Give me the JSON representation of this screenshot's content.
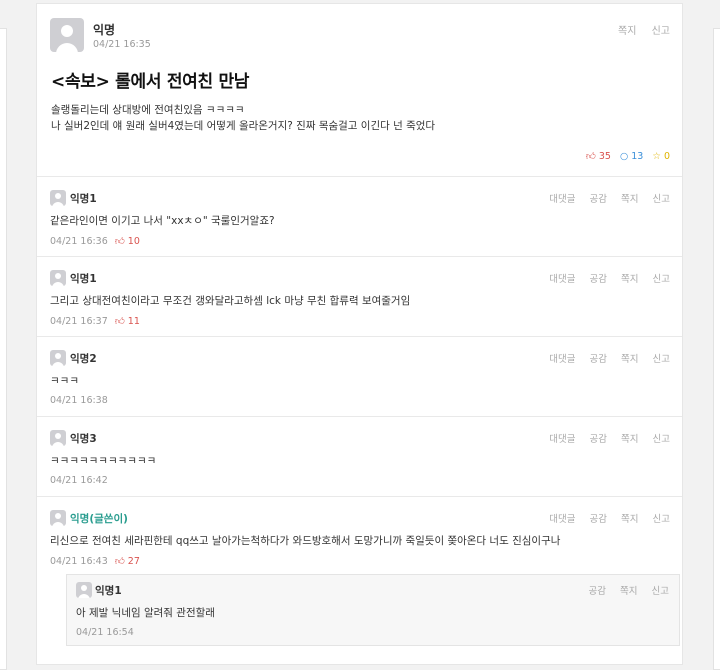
{
  "post": {
    "author": "익명",
    "date": "04/21 16:35",
    "actions": [
      "쪽지",
      "신고"
    ],
    "title": "<속보> 롤에서 전여친 만남",
    "body": [
      "솔랭돌리는데 상대방에 전여친있음 ㅋㅋㅋㅋ",
      "나 실버2인데 얘 원래 실버4였는데 어떻게 올라온거지? 진짜 목숨걸고 이긴다 넌 죽었다"
    ],
    "likes": "35",
    "comments": "13",
    "scraps": "0"
  },
  "comments": [
    {
      "author": "익명1",
      "text": "같은라인이면 이기고 나서 \"xxㅊㅇ\" 국룰인거알죠?",
      "date": "04/21 16:36",
      "likes": "10"
    },
    {
      "author": "익명1",
      "text": "그리고 상대전여친이라고 무조건 갱와달라고하셈 lck 마냥 무친 합류력 보여줄거임",
      "date": "04/21 16:37",
      "likes": "11"
    },
    {
      "author": "익명2",
      "text": "ㅋㅋㅋ",
      "date": "04/21 16:38",
      "likes": ""
    },
    {
      "author": "익명3",
      "text": "ㅋㅋㅋㅋㅋㅋㅋㅋㅋㅋㅋ",
      "date": "04/21 16:42",
      "likes": ""
    },
    {
      "author": "익명(글쓴이)",
      "text": "리신으로 전여친 세라핀한테 qq쓰고 날아가는척하다가 와드방호해서 도망가니까 죽일듯이 쫒아온다 너도 진심이구나",
      "date": "04/21 16:43",
      "likes": "27"
    }
  ],
  "comment_actions": [
    "대댓글",
    "공감",
    "쪽지",
    "신고"
  ],
  "reply": {
    "author": "익명1",
    "text": "아 제발 닉네임 알려줘 관전할래",
    "date": "04/21 16:54",
    "actions": [
      "공감",
      "쪽지",
      "신고"
    ]
  },
  "icons": {
    "like": "thumbs-up-icon",
    "comment": "speech-bubble-icon",
    "scrap": "star-icon"
  },
  "colors": {
    "like": "#d9534f",
    "comment": "#3a8fd9",
    "scrap": "#e0b400",
    "writer": "#2a9d8f"
  }
}
